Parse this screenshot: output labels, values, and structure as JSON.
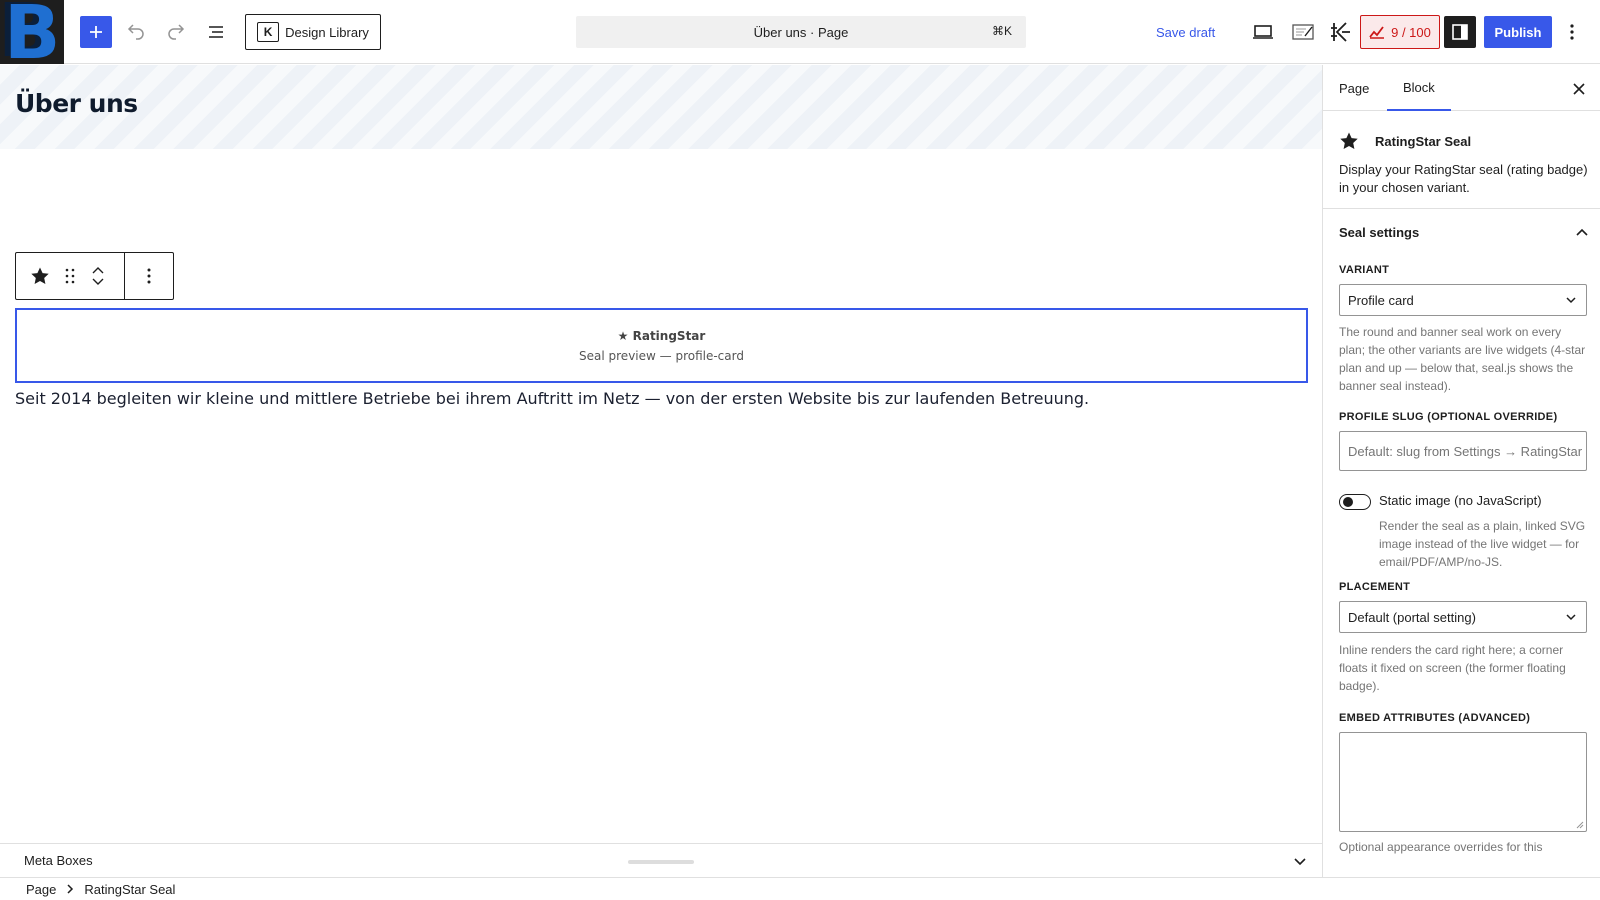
{
  "topbar": {
    "logo_letter": "B",
    "design_library_label": "Design Library",
    "command_title": "Über uns · Page",
    "command_shortcut": "⌘K",
    "save_draft_label": "Save draft",
    "score_label": "9 / 100",
    "publish_label": "Publish"
  },
  "canvas": {
    "page_title": "Über uns",
    "seal_preview": {
      "name": "★ RatingStar",
      "subtitle": "Seal preview — profile-card"
    },
    "paragraph": "Seit 2014 begleiten wir kleine und mittlere Betriebe bei ihrem Auftritt im Netz — von der ersten Website bis zur laufenden Betreuung."
  },
  "meta_boxes": {
    "label": "Meta Boxes"
  },
  "breadcrumb": [
    "Page",
    "RatingStar Seal"
  ],
  "sidebar": {
    "tabs": [
      "Page",
      "Block"
    ],
    "active_tab": "Block",
    "block": {
      "title": "RatingStar Seal",
      "description": "Display your RatingStar seal (rating badge) in your chosen variant."
    },
    "panel_title": "Seal settings",
    "variant": {
      "label": "Variant",
      "value": "Profile card",
      "help": "The round and banner seal work on every plan; the other variants are live widgets (4-star plan and up — below that, seal.js shows the banner seal instead)."
    },
    "profile_slug": {
      "label": "Profile slug (optional override)",
      "placeholder": "Default: slug from Settings → RatingStar",
      "value": ""
    },
    "static_image": {
      "label": "Static image (no JavaScript)",
      "help": "Render the seal as a plain, linked SVG image instead of the live widget — for email/PDF/AMP/no-JS.",
      "checked": false
    },
    "placement": {
      "label": "Placement",
      "value": "Default (portal setting)",
      "help": "Inline renders the card right here; a corner floats it fixed on screen (the former floating badge)."
    },
    "embed_attributes": {
      "label": "Embed attributes (advanced)",
      "help": "Optional appearance overrides for this"
    }
  },
  "colors": {
    "accent": "#3858e9",
    "score_red": "#cc1818",
    "text": "#1e1e1e",
    "muted": "#757575"
  }
}
